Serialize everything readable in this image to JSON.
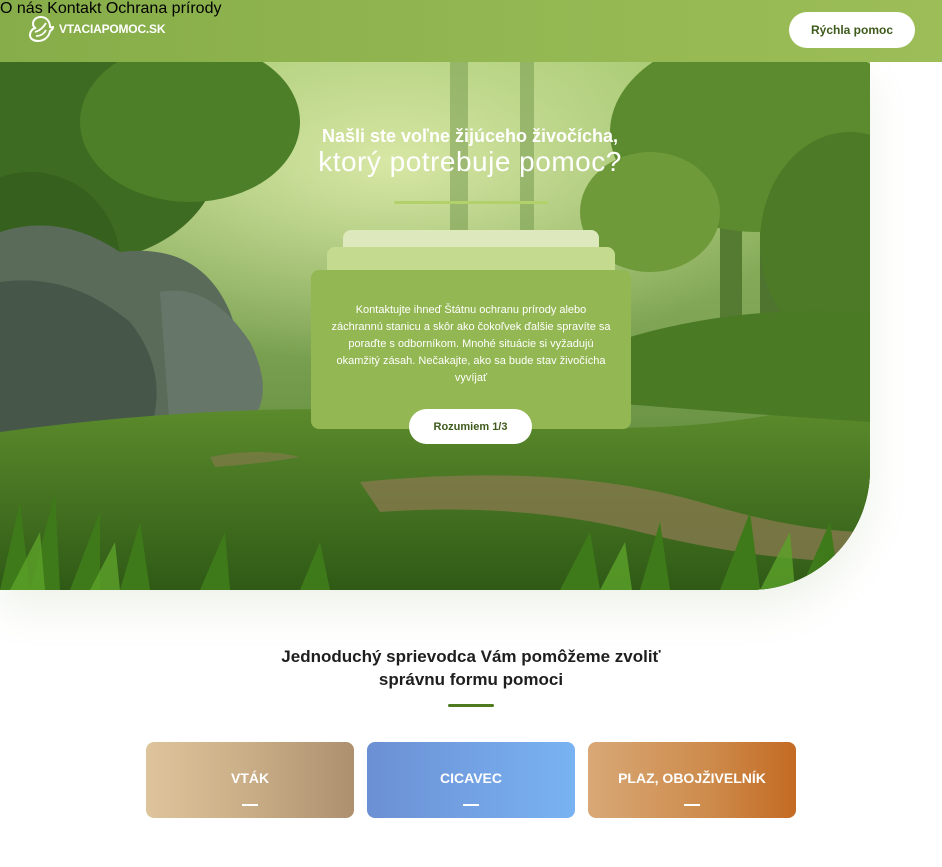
{
  "header": {
    "logo_text": "VTACIAPOMOC.SK",
    "nav": [
      "O nás",
      "Kontakt",
      "Ochrana prírody"
    ],
    "cta_label": "Rýchla pomoc"
  },
  "hero": {
    "title_line1": "Našli ste voľne žijúceho živočícha,",
    "title_line2": "ktorý potrebuje pomoc?",
    "card_text": "Kontaktujte ihneď Štátnu ochranu prírody alebo záchrannú stanicu a skôr ako čokoľvek ďalšie spravíte sa poraďte s odborníkom. Mnohé situácie si vyžadujú okamžitý zásah. Nečakajte, ako sa bude stav živočícha vyvíjať",
    "button_label": "Rozumiem 1/3"
  },
  "guide": {
    "title_line1": "Jednoduchý sprievodca Vám pomôžeme zvoliť",
    "title_line2": "správnu formu pomoci",
    "categories": [
      {
        "label": "VTÁK"
      },
      {
        "label": "CICAVEC"
      },
      {
        "label": "PLAZ, OBOJŽIVELNÍK"
      }
    ]
  },
  "colors": {
    "header_green": "#93b752",
    "accent_dark_green": "#4f7a1f",
    "card_green": "#93b752"
  }
}
